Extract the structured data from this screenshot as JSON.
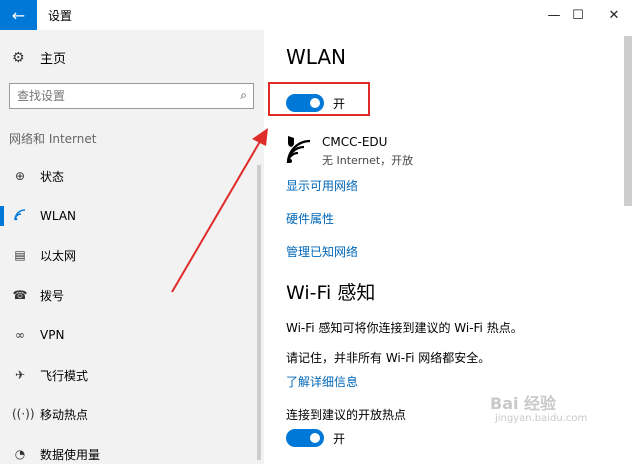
{
  "window": {
    "title": "设置",
    "back_glyph": "←",
    "min_glyph": "—",
    "max_glyph": "☐",
    "close_glyph": "✕"
  },
  "sidebar": {
    "home_label": "主页",
    "search_placeholder": "查找设置",
    "section_label": "网络和 Internet",
    "items": [
      {
        "label": "状态",
        "icon": "globe-icon"
      },
      {
        "label": "WLAN",
        "icon": "wifi-icon",
        "active": true
      },
      {
        "label": "以太网",
        "icon": "ethernet-icon"
      },
      {
        "label": "拨号",
        "icon": "phone-icon"
      },
      {
        "label": "VPN",
        "icon": "vpn-icon"
      },
      {
        "label": "飞行模式",
        "icon": "airplane-icon"
      },
      {
        "label": "移动热点",
        "icon": "hotspot-icon"
      },
      {
        "label": "数据使用量",
        "icon": "data-usage-icon"
      }
    ]
  },
  "main": {
    "title": "WLAN",
    "wlan_toggle_label": "开",
    "network": {
      "name": "CMCC-EDU",
      "status": "无 Internet，开放"
    },
    "links": [
      "显示可用网络",
      "硬件属性",
      "管理已知网络"
    ],
    "wifi_sense_title": "Wi-Fi 感知",
    "wifi_sense_desc": "Wi-Fi 感知可将你连接到建议的 Wi-Fi 热点。",
    "wifi_sense_note": "请记住，并非所有 Wi-Fi 网络都安全。",
    "learn_more": "了解详细信息",
    "suggested_hotspots_label": "连接到建议的开放热点",
    "suggested_toggle_label": "开"
  },
  "colors": {
    "accent": "#0078d7",
    "link": "#0067b8",
    "annotation": "#e02b2b",
    "sidebar_bg": "#f2f2f2"
  },
  "watermark": {
    "text": "Bai 经验",
    "sub": "jingyan.baidu.com"
  }
}
